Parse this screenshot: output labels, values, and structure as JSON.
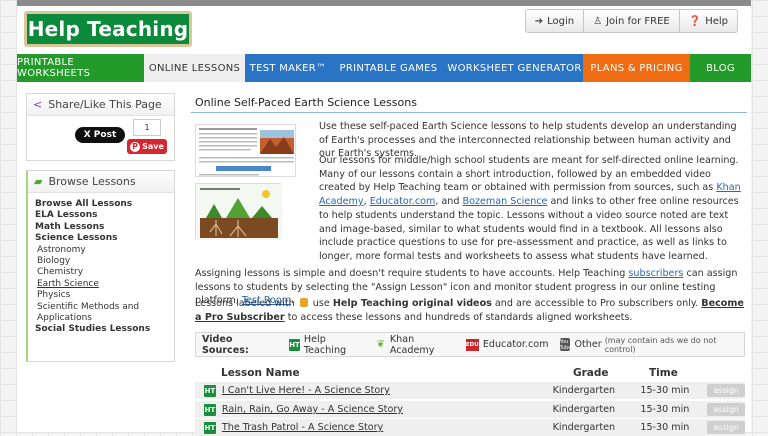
{
  "header": {
    "logo_text": "Help Teaching",
    "login": "Login",
    "join": "Join for FREE",
    "help": "Help"
  },
  "nav": [
    {
      "label": "PRINTABLE WORKSHEETS"
    },
    {
      "label": "ONLINE LESSONS"
    },
    {
      "label": "TEST MAKER™"
    },
    {
      "label": "PRINTABLE GAMES"
    },
    {
      "label": "WORKSHEET GENERATOR"
    },
    {
      "label": "PLANS & PRICING"
    },
    {
      "label": "BLOG"
    }
  ],
  "sidebar": {
    "share_title": "Share/Like This Page",
    "x_post": "X Post",
    "count": "1",
    "save": "Save",
    "browse_title": "Browse Lessons",
    "items": [
      {
        "label": "Browse All Lessons"
      },
      {
        "label": "ELA Lessons"
      },
      {
        "label": "Math Lessons"
      },
      {
        "label": "Science Lessons"
      },
      {
        "label": "Astronomy"
      },
      {
        "label": "Biology"
      },
      {
        "label": "Chemistry"
      },
      {
        "label": "Earth Science"
      },
      {
        "label": "Physics"
      },
      {
        "label": "Scientific Methods and"
      },
      {
        "label": "Applications"
      },
      {
        "label": "Social Studies Lessons"
      }
    ]
  },
  "main": {
    "title": "Online Self-Paced Earth Science Lessons",
    "p1": "Use these self-paced Earth Science lessons to help students develop an understanding of Earth's processes and the interconnected relationship between human activity and our Earth's systems.",
    "p2a": "Our lessons for middle/high school students are meant for self-directed online learning. Many of our lessons contain a short introduction, followed by an embedded video created by Help Teaching team or obtained with permission from sources, such as ",
    "link_khan": "Khan Academy",
    "sep1": ", ",
    "link_edu": "Educator.com",
    "sep2": ", and ",
    "link_bozeman": "Bozeman Science",
    "p2b": " and links to other free online resources to help students understand the topic. Lessons without a video source noted are text and image-based, similar to what students would find in a textbook. All lessons also include practice questions to use for pre-assessment and practice, as well as links to longer, more formal tests and worksheets to assess what students have learned.",
    "p3a": "Assigning lessons is simple and doesn't require students to have accounts. Help Teaching ",
    "link_subscribers": "subscribers",
    "p3b": " can assign lessons to students by selecting the \"Assign Lesson\" icon and monitor student progress in our online testing platform, ",
    "link_testroom": "Test Room",
    "p3c": ".",
    "p4a": "Lessons labeled with ",
    "p4b": " use ",
    "p4bold": "Help Teaching original videos",
    "p4c": " and are accessible to Pro subscribers only. ",
    "link_pro": "Become a Pro Subscriber",
    "p4d": " to access these lessons and hundreds of standards aligned worksheets."
  },
  "video_sources": {
    "label": "Video Sources:",
    "items": [
      "Help Teaching",
      "Khan Academy",
      "Educator.com",
      "Other"
    ],
    "note": "(may contain ads we do not control)",
    "ht_badge": "HT",
    "edu_badge": "EDU",
    "yt_badge": "You Tube"
  },
  "table": {
    "headers": {
      "lesson": "Lesson Name",
      "grade": "Grade",
      "time": "Time"
    },
    "rows": [
      {
        "name": "I Can't Live Here! - A Science Story",
        "grade": "Kindergarten",
        "time": "15-30 min",
        "assign": "assign"
      },
      {
        "name": "Rain, Rain, Go Away - A Science Story",
        "grade": "Kindergarten",
        "time": "15-30 min",
        "assign": "assign"
      },
      {
        "name": "The Trash Patrol - A Science Story",
        "grade": "Kindergarten",
        "time": "15-30 min",
        "assign": "assign"
      }
    ]
  }
}
